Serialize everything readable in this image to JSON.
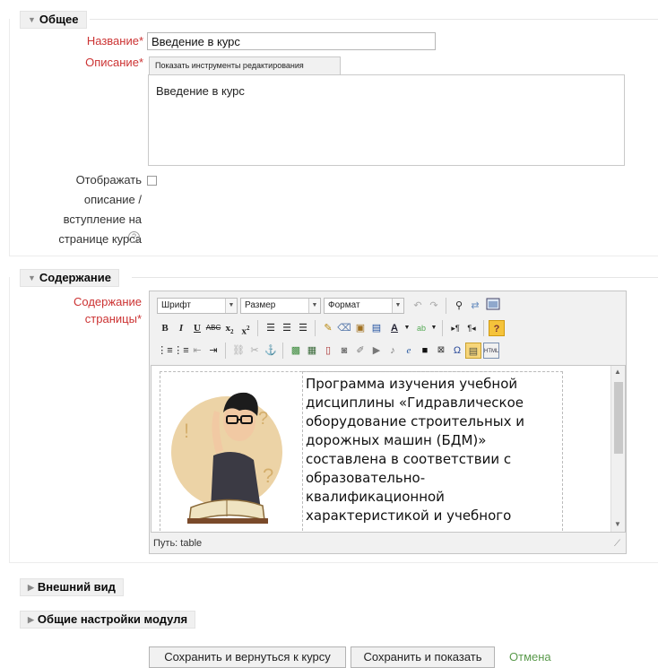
{
  "sections": {
    "general": "Общее",
    "content": "Содержание",
    "appearance": "Внешний вид",
    "module_settings": "Общие настройки модуля"
  },
  "fields": {
    "name_label": "Название",
    "name_value": "Введение в курс",
    "description_label": "Описание",
    "required_mark": "*",
    "show_tools_button": "Показать инструменты редактирования",
    "description_value": "Введение в курс",
    "display_label_1": "Отображать",
    "display_label_2": "описание /",
    "display_label_3": "вступление на",
    "display_label_4": "странице курса",
    "help_icon_glyph": "?",
    "page_content_label_1": "Содержание",
    "page_content_label_2": "страницы"
  },
  "editor": {
    "font_select": "Шрифт",
    "size_select": "Размер",
    "format_select": "Формат",
    "path": "Путь: table",
    "text": "Программа изучения учебной дисциплины «Гидравлическое оборудование строительных и дорожных машин (БДМ)» составлена в соответствии с образовательно-квалификационной характеристикой и учебного"
  },
  "buttons": {
    "save_return": "Сохранить и вернуться к курсу",
    "save_show": "Сохранить и показать",
    "cancel": "Отмена"
  },
  "colors": {
    "required": "#cc3333",
    "cancel_link": "#5a9a4c"
  }
}
